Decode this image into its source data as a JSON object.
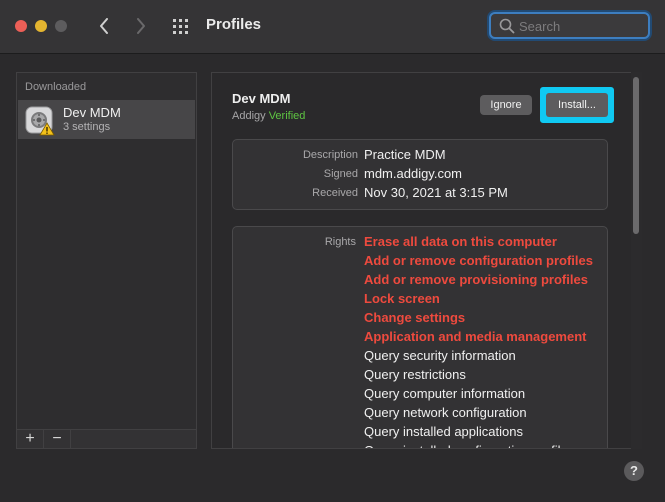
{
  "window": {
    "title": "Profiles"
  },
  "search": {
    "placeholder": "Search"
  },
  "sidebar": {
    "section_label": "Downloaded",
    "items": [
      {
        "name": "Dev MDM",
        "detail": "3 settings"
      }
    ],
    "add_label": "+",
    "remove_label": "−"
  },
  "profile": {
    "name": "Dev MDM",
    "organization": "Addigy",
    "verified_label": "Verified",
    "ignore_label": "Ignore",
    "install_label": "Install...",
    "description_label": "Description",
    "description": "Practice MDM",
    "signed_label": "Signed",
    "signed": "mdm.addigy.com",
    "received_label": "Received",
    "received": "Nov 30, 2021 at 3:15 PM",
    "rights_label": "Rights",
    "rights": [
      {
        "text": "Erase all data on this computer",
        "warning": true
      },
      {
        "text": "Add or remove configuration profiles",
        "warning": true
      },
      {
        "text": "Add or remove provisioning profiles",
        "warning": true
      },
      {
        "text": "Lock screen",
        "warning": true
      },
      {
        "text": "Change settings",
        "warning": true
      },
      {
        "text": "Application and media management",
        "warning": true
      },
      {
        "text": "Query security information",
        "warning": false
      },
      {
        "text": "Query restrictions",
        "warning": false
      },
      {
        "text": "Query computer information",
        "warning": false
      },
      {
        "text": "Query network configuration",
        "warning": false
      },
      {
        "text": "Query installed applications",
        "warning": false
      },
      {
        "text": "Query installed configuration profiles",
        "warning": false
      }
    ]
  },
  "help": {
    "label": "?"
  },
  "colors": {
    "accent": "#10c9f2",
    "verified": "#5ec542",
    "warning": "#ee4a3e"
  }
}
